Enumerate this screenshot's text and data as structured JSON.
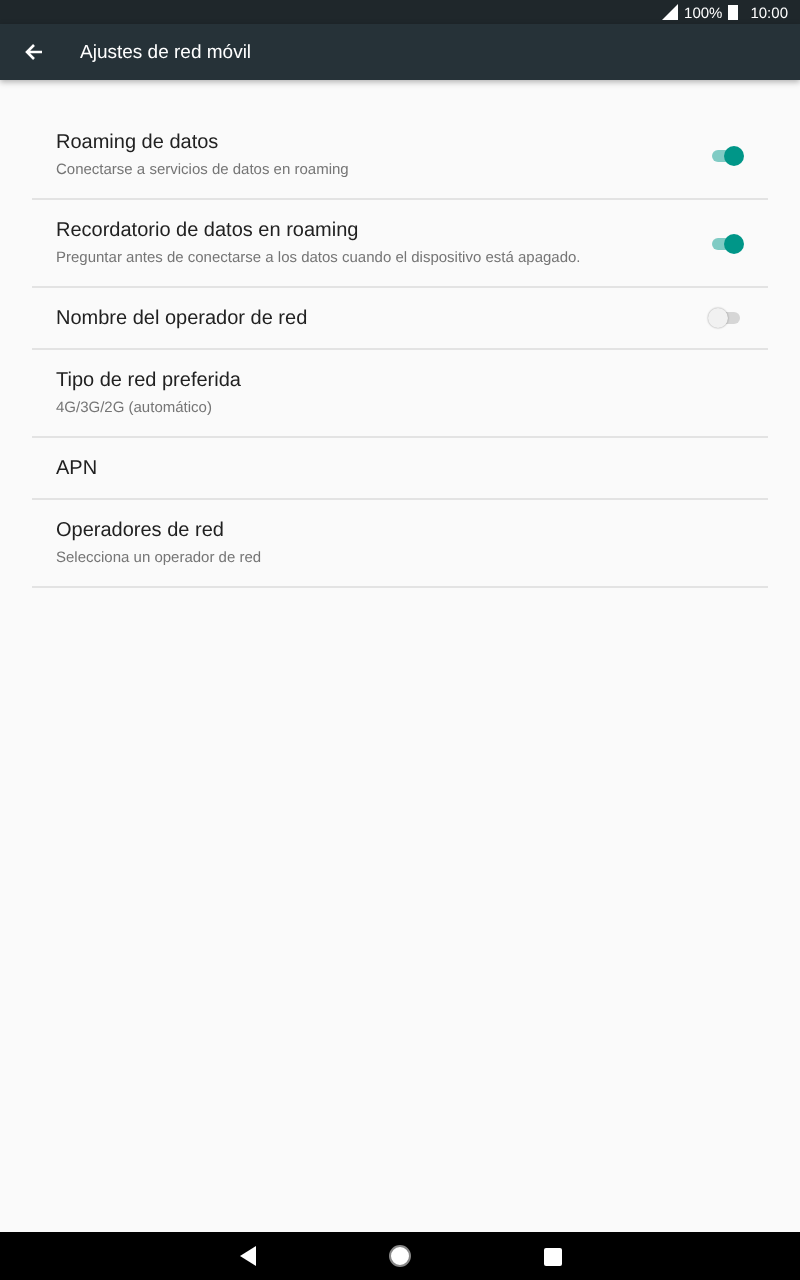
{
  "status_bar": {
    "battery": "100%",
    "time": "10:00"
  },
  "toolbar": {
    "title": "Ajustes de red móvil"
  },
  "settings": [
    {
      "kind": "switch",
      "title": "Roaming de datos",
      "summary": "Conectarse a servicios de datos en roaming",
      "on": true
    },
    {
      "kind": "switch",
      "title": "Recordatorio de datos en roaming",
      "summary": "Preguntar antes de conectarse a los datos cuando el dispositivo está apagado.",
      "on": true
    },
    {
      "kind": "switch",
      "title": "Nombre del operador de red",
      "on": false
    },
    {
      "kind": "link",
      "title": "Tipo de red preferida",
      "summary": "4G/3G/2G (automático)"
    },
    {
      "kind": "link",
      "title": "APN"
    },
    {
      "kind": "link",
      "title": "Operadores de red",
      "summary": "Selecciona un operador de red"
    }
  ]
}
